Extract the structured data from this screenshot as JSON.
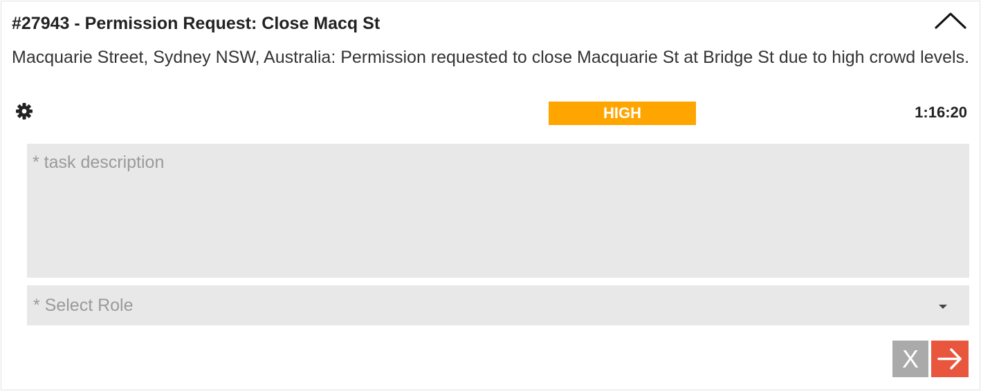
{
  "task": {
    "title": "#27943 - Permission Request: Close Macq St",
    "description": "Macquarie Street, Sydney NSW, Australia: Permission requested to close Macquarie St at Bridge St due to high crowd levels.",
    "priority": "HIGH",
    "timer": "1:16:20"
  },
  "form": {
    "task_description_placeholder": "* task description",
    "role_placeholder": "* Select Role",
    "cancel_label": "X"
  },
  "icons": {
    "collapse": "chevron-up-icon",
    "settings": "gear-icon",
    "dropdown": "caret-down-icon",
    "submit": "arrow-right-icon"
  },
  "colors": {
    "priority_high": "#ffa500",
    "submit": "#e8563e",
    "cancel": "#aaaaaa",
    "field_bg": "#e8e8e8"
  }
}
